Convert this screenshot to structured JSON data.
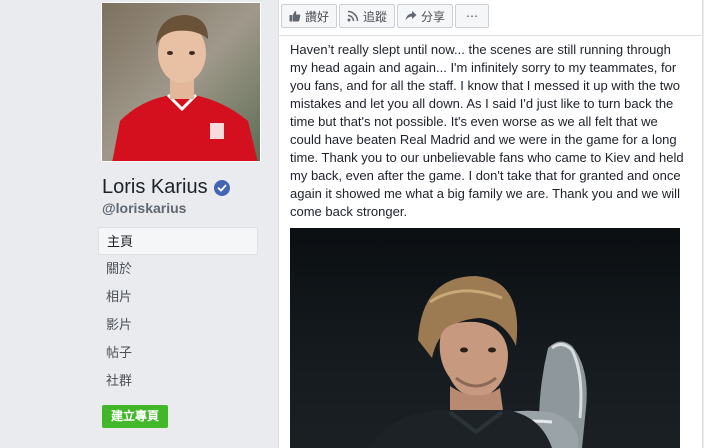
{
  "profile": {
    "name": "Loris Karius",
    "handle": "@loriskarius",
    "verified": true
  },
  "nav": {
    "items": [
      {
        "label": "主頁",
        "active": true
      },
      {
        "label": "關於"
      },
      {
        "label": "相片"
      },
      {
        "label": "影片"
      },
      {
        "label": "帖子"
      },
      {
        "label": "社群"
      }
    ],
    "create_page_label": "建立專頁"
  },
  "post_actions": {
    "like": "讚好",
    "follow": "追蹤",
    "share": "分享",
    "more": "⋯"
  },
  "post": {
    "text": "Haven’t really slept until now... the scenes are still running through my head again and again... I'm infinitely sorry to my teammates, for you fans, and for all the staff. I know that I messed it up with the two mistakes and let you all down. As I said I'd just like to turn back the time but that's not possible. It's even worse as we all felt that we could have beaten Real Madrid and we were in the game for a long time. Thank you to our unbelievable fans who came to Kiev and held my back, even after the game. I don't take that for granted and once again it showed me what a big family we are. Thank you and we will come back stronger."
  },
  "colors": {
    "background": "#e9ebee",
    "verified_blue": "#4267b2",
    "create_button_green": "#42b72a",
    "kit_red": "#d4101e"
  }
}
